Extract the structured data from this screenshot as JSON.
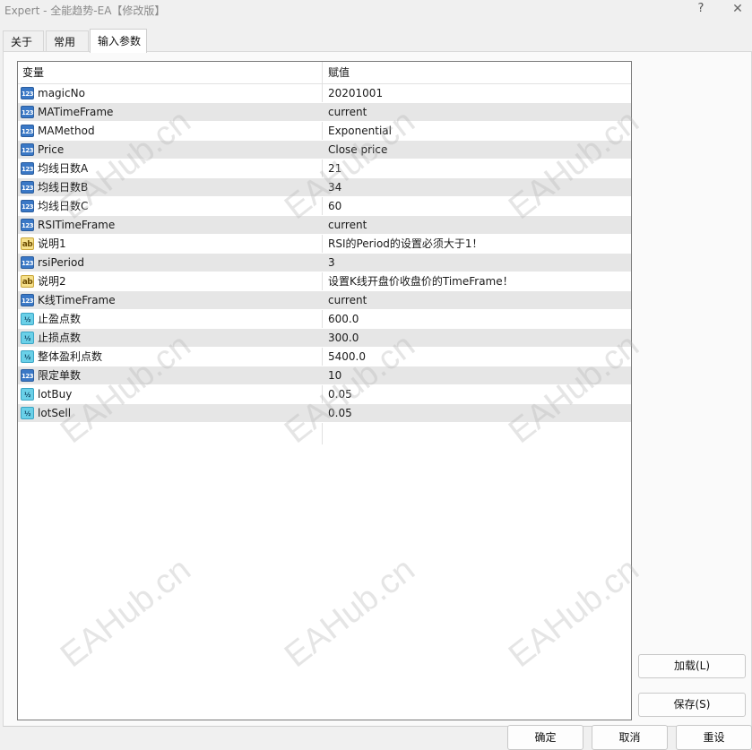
{
  "window": {
    "title": "Expert - 全能趋势-EA【修改版】",
    "help_label": "?",
    "close_label": "✕"
  },
  "tabs": [
    {
      "label": "关于"
    },
    {
      "label": "常用"
    },
    {
      "label": "输入参数"
    }
  ],
  "grid": {
    "col_variable": "变量",
    "col_value": "赋值",
    "rows": [
      {
        "type": "int",
        "icon": "123",
        "name": "magicNo",
        "value": "20201001"
      },
      {
        "type": "int",
        "icon": "123",
        "name": "MATimeFrame",
        "value": "current"
      },
      {
        "type": "int",
        "icon": "123",
        "name": "MAMethod",
        "value": "Exponential"
      },
      {
        "type": "int",
        "icon": "123",
        "name": "Price",
        "value": "Close price"
      },
      {
        "type": "int",
        "icon": "123",
        "name": "均线日数A",
        "value": "21"
      },
      {
        "type": "int",
        "icon": "123",
        "name": "均线日数B",
        "value": "34"
      },
      {
        "type": "int",
        "icon": "123",
        "name": "均线日数C",
        "value": "60"
      },
      {
        "type": "int",
        "icon": "123",
        "name": "RSITimeFrame",
        "value": "current"
      },
      {
        "type": "str",
        "icon": "ab",
        "name": "说明1",
        "value": "RSI的Period的设置必须大于1！"
      },
      {
        "type": "int",
        "icon": "123",
        "name": "rsiPeriod",
        "value": "3"
      },
      {
        "type": "str",
        "icon": "ab",
        "name": "说明2",
        "value": "设置K线开盘价收盘价的TimeFrame！"
      },
      {
        "type": "int",
        "icon": "123",
        "name": "K线TimeFrame",
        "value": "current"
      },
      {
        "type": "dbl",
        "icon": "½",
        "name": "止盈点数",
        "value": "600.0"
      },
      {
        "type": "dbl",
        "icon": "½",
        "name": "止损点数",
        "value": "300.0"
      },
      {
        "type": "dbl",
        "icon": "½",
        "name": "整体盈利点数",
        "value": "5400.0"
      },
      {
        "type": "int",
        "icon": "123",
        "name": "限定单数",
        "value": "10"
      },
      {
        "type": "dbl",
        "icon": "½",
        "name": "lotBuy",
        "value": "0.05"
      },
      {
        "type": "dbl",
        "icon": "½",
        "name": "lotSell",
        "value": "0.05"
      }
    ]
  },
  "buttons": {
    "load": "加载(L)",
    "save": "保存(S)",
    "ok": "确定",
    "cancel": "取消",
    "reset": "重设"
  },
  "watermark": "EAHub.cn"
}
